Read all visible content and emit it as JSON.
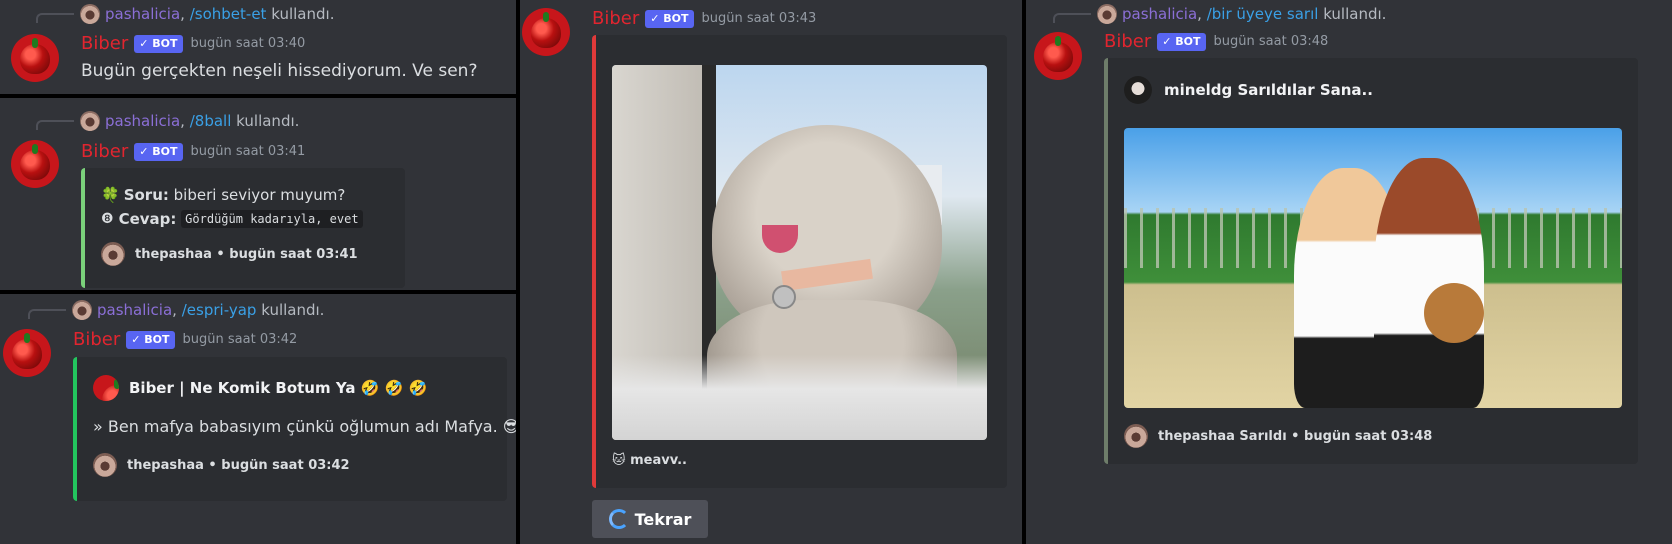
{
  "panel1": {
    "user": "pashalicia",
    "sep": ",",
    "command": "/sohbet-et",
    "used": "kullandı.",
    "bot_name": "Biber",
    "badge": "✓ BOT",
    "time": "bugün saat 03:40",
    "text": "Bugün gerçekten neşeli hissediyorum. Ve sen?"
  },
  "panel2": {
    "user": "pashalicia",
    "sep": ",",
    "command": "/8ball",
    "used": "kullandı.",
    "bot_name": "Biber",
    "badge": "✓ BOT",
    "time": "bugün saat 03:41",
    "q_icon": "🍀",
    "q_label": "Soru:",
    "q_text": "biberi seviyor muyum?",
    "a_icon": "❽",
    "a_label": "Cevap:",
    "a_text": "Gördüğüm kadarıyla, evet",
    "footer": "thepashaa • bugün saat 03:41",
    "accent": "#7bd17b"
  },
  "panel3": {
    "user": "pashalicia",
    "sep": ",",
    "command": "/espri-yap",
    "used": "kullandı.",
    "bot_name": "Biber",
    "badge": "✓ BOT",
    "time": "bugün saat 03:42",
    "embed_title": "Biber | Ne Komik Botum Ya 🤣 🤣 🤣",
    "joke": "» Ben mafya babasıyım çünkü oğlumun adı Mafya. 😎",
    "footer": "thepashaa • bugün saat 03:42",
    "accent": "#23c55e"
  },
  "panel4": {
    "bot_name": "Biber",
    "badge": "✓ BOT",
    "time": "bugün saat 03:43",
    "caption": "🐱 meavv..",
    "button": "Tekrar",
    "button_icon": "refresh-icon",
    "accent": "#e03a3a"
  },
  "panel5": {
    "user": "pashalicia",
    "sep": ",",
    "command": "/bir üyeye sarıl",
    "used": "kullandı.",
    "bot_name": "Biber",
    "badge": "✓ BOT",
    "time": "bugün saat 03:48",
    "embed_title": "mineldg Sarıldılar Sana..",
    "footer": "thepashaa Sarıldı • bugün saat 03:48",
    "accent": "#6e7d6a"
  }
}
